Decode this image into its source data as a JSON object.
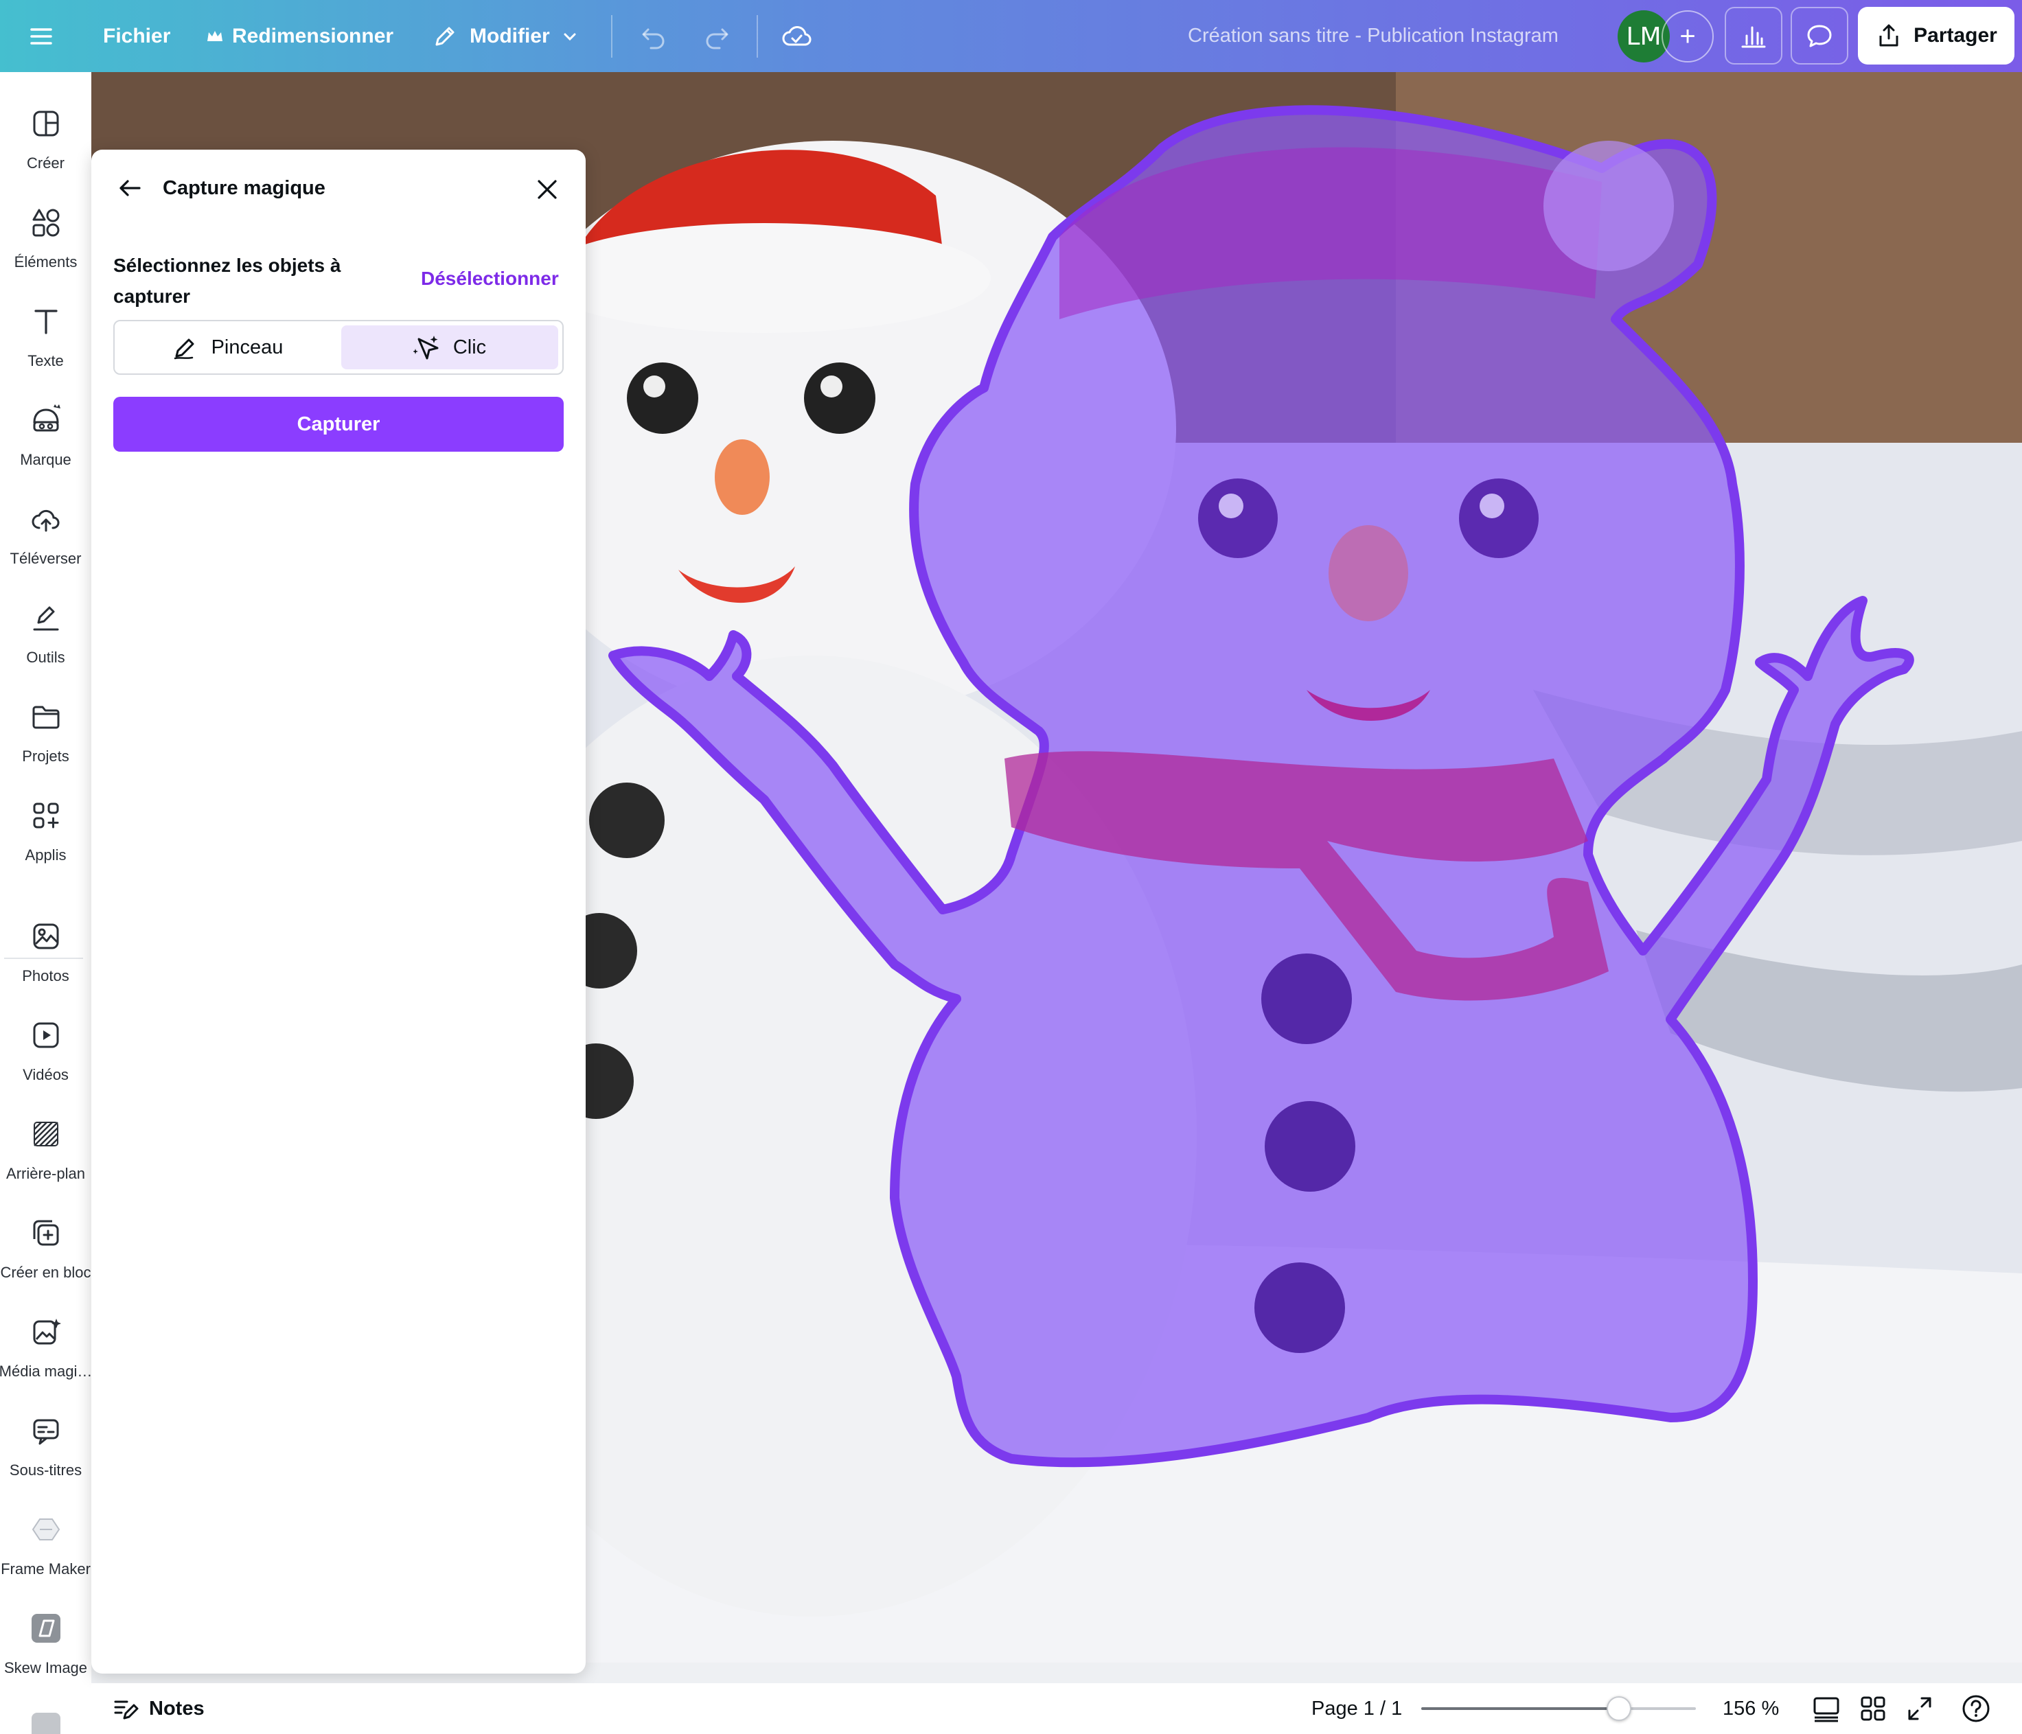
{
  "topbar": {
    "file_label": "Fichier",
    "resize_label": "Redimensionner",
    "edit_label": "Modifier",
    "document_title": "Création sans titre - Publication Instagram",
    "avatar_initials": "LM",
    "add_label": "+",
    "share_label": "Partager",
    "crown_icon": "crown-icon"
  },
  "sidebar": {
    "items": [
      {
        "label": "Créer",
        "icon": "create-icon"
      },
      {
        "label": "Éléments",
        "icon": "elements-icon"
      },
      {
        "label": "Texte",
        "icon": "text-icon"
      },
      {
        "label": "Marque",
        "icon": "brand-icon"
      },
      {
        "label": "Téléverser",
        "icon": "upload-cloud-icon"
      },
      {
        "label": "Outils",
        "icon": "draw-tools-icon"
      },
      {
        "label": "Projets",
        "icon": "folder-icon"
      },
      {
        "label": "Applis",
        "icon": "apps-icon"
      },
      {
        "label": "Photos",
        "icon": "photos-icon"
      },
      {
        "label": "Vidéos",
        "icon": "videos-icon"
      },
      {
        "label": "Arrière-plan",
        "icon": "background-icon"
      },
      {
        "label": "Créer en bloc",
        "icon": "bulk-create-icon"
      },
      {
        "label": "Média magi…",
        "icon": "magic-media-icon"
      },
      {
        "label": "Sous-titres",
        "icon": "subtitles-icon"
      },
      {
        "label": "Frame Maker",
        "icon": "frame-maker-icon"
      },
      {
        "label": "Skew Image",
        "icon": "skew-image-icon"
      }
    ]
  },
  "panel": {
    "title": "Capture magique",
    "subtitle": "Sélectionnez les objets à capturer",
    "deselect_label": "Désélectionner",
    "mode_brush": "Pinceau",
    "mode_click": "Clic",
    "selected_mode": "Clic",
    "capture_label": "Capturer"
  },
  "bottombar": {
    "notes_label": "Notes",
    "page_info": "Page 1 / 1",
    "zoom_label": "156 %",
    "zoom_fraction": 0.72
  },
  "colors": {
    "accent": "#8b3dff",
    "accent_text": "#7d2ae8",
    "selection_fill": "#8b5cf6",
    "selection_stroke": "#7c3aed",
    "avatar_bg": "#1e7d35"
  }
}
